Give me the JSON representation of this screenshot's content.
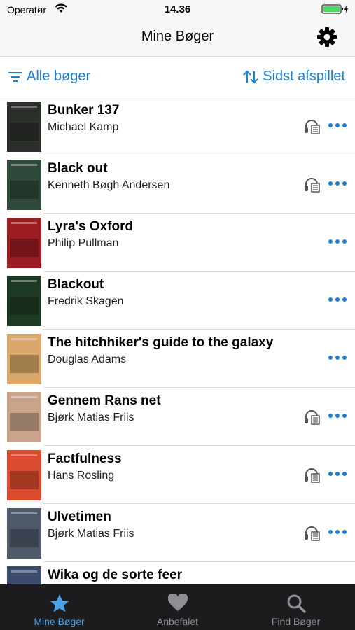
{
  "status": {
    "carrier": "Operatør",
    "time": "14.36"
  },
  "nav": {
    "title": "Mine Bøger"
  },
  "filter": {
    "filter_label": "Alle bøger",
    "sort_label": "Sidst afspillet"
  },
  "books": [
    {
      "title": "Bunker 137",
      "author": "Michael Kamp",
      "audio": true,
      "cover_color": "#2b2f2a",
      "cover_text": "BUNKER 137"
    },
    {
      "title": "Black out",
      "author": "Kenneth Bøgh Andersen",
      "audio": true,
      "cover_color": "#2f4a3a",
      "cover_text": "BLACK OUT"
    },
    {
      "title": "Lyra's Oxford",
      "author": "Philip Pullman",
      "audio": false,
      "cover_color": "#9b1c22",
      "cover_text": "PULLMAN"
    },
    {
      "title": "Blackout",
      "author": "Fredrik Skagen",
      "audio": false,
      "cover_color": "#1f3a24",
      "cover_text": ""
    },
    {
      "title": "The hitchhiker's guide to the galaxy",
      "author": "Douglas Adams",
      "audio": false,
      "cover_color": "#d9a86a",
      "cover_text": "GALAXY"
    },
    {
      "title": "Gennem Rans net",
      "author": "Bjørk Matias Friis",
      "audio": true,
      "cover_color": "#c9a48a",
      "cover_text": ""
    },
    {
      "title": "Factfulness",
      "author": "Hans Rosling",
      "audio": true,
      "cover_color": "#d94a2e",
      "cover_text": "FACTFULNESS"
    },
    {
      "title": "Ulvetimen",
      "author": "Bjørk Matias Friis",
      "audio": true,
      "cover_color": "#4e5a6a",
      "cover_text": ""
    },
    {
      "title": "Wika og de sorte feer",
      "author": "",
      "audio": false,
      "cover_color": "#3a4a6a",
      "cover_text": ""
    }
  ],
  "tabs": [
    {
      "label": "Mine Bøger",
      "icon": "star-icon",
      "active": true
    },
    {
      "label": "Anbefalet",
      "icon": "heart-icon",
      "active": false
    },
    {
      "label": "Find Bøger",
      "icon": "search-icon",
      "active": false
    }
  ],
  "colors": {
    "accent": "#1a7fd6",
    "tab_bg": "#1c1c1e",
    "tab_active": "#4aa3e8",
    "tab_inactive": "#8e8e93"
  }
}
